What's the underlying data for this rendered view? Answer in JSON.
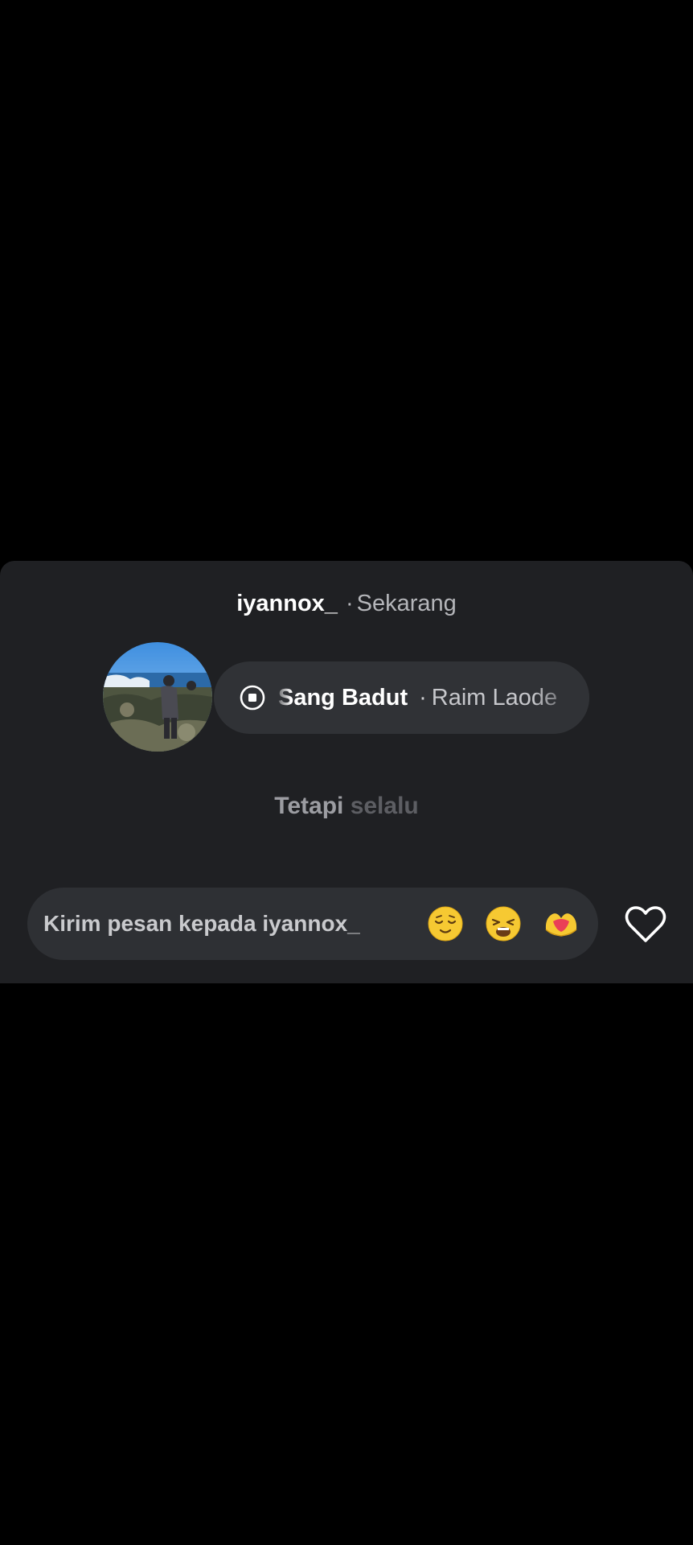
{
  "story_reply": {
    "username": "iyannox_",
    "separator": "·",
    "timestamp": "Sekarang"
  },
  "music": {
    "song_title": "Sang Badut",
    "separator": "·",
    "artist": "Raim Laode"
  },
  "lyrics": {
    "sung": "Tetapi ",
    "upcoming": "selalu"
  },
  "message": {
    "placeholder": "Kirim pesan kepada iyannox_"
  },
  "quick_reactions": [
    "relieved-face",
    "weary-face",
    "heart-hands"
  ],
  "colors": {
    "background": "#000000",
    "panel": "#1f2023",
    "pill": "#303236",
    "input": "#2e3034"
  }
}
